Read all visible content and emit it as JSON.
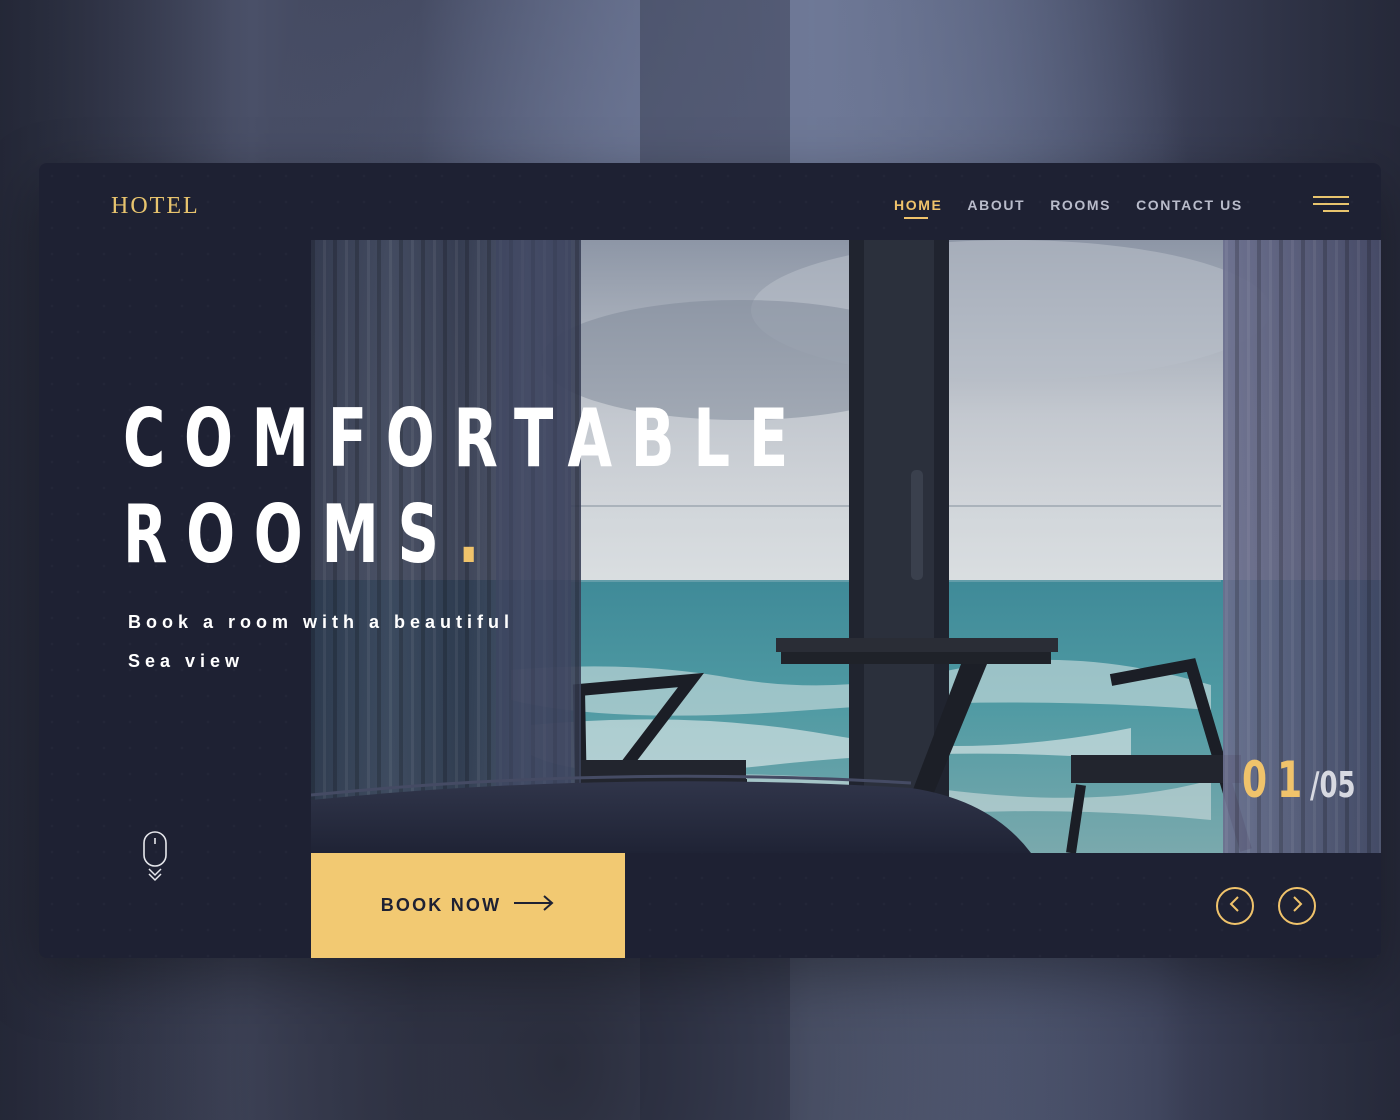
{
  "brand": {
    "logo_text": "HOTEL",
    "accent_color": "#f0c36b",
    "panel_color": "#1e2133"
  },
  "nav": {
    "items": [
      {
        "label": "HOME",
        "active": true
      },
      {
        "label": "ABOUT",
        "active": false
      },
      {
        "label": "ROOMS",
        "active": false
      },
      {
        "label": "CONTACT US",
        "active": false
      }
    ],
    "menu_icon": "hamburger-menu-icon"
  },
  "hero": {
    "headline_line1": "COMFORTABLE",
    "headline_line2": "ROOMS",
    "headline_dot": ".",
    "subline_line1": "Book a room with a beautiful",
    "subline_line2": "Sea view",
    "image": "hotel room with balcony and sea view"
  },
  "cta": {
    "label": "BOOK NOW",
    "icon": "long-arrow-right-icon"
  },
  "slider": {
    "current": "01",
    "total": "/05",
    "prev_icon": "chevron-left-icon",
    "next_icon": "chevron-right-icon"
  },
  "scroll_indicator": {
    "icon": "mouse-scroll-icon"
  }
}
